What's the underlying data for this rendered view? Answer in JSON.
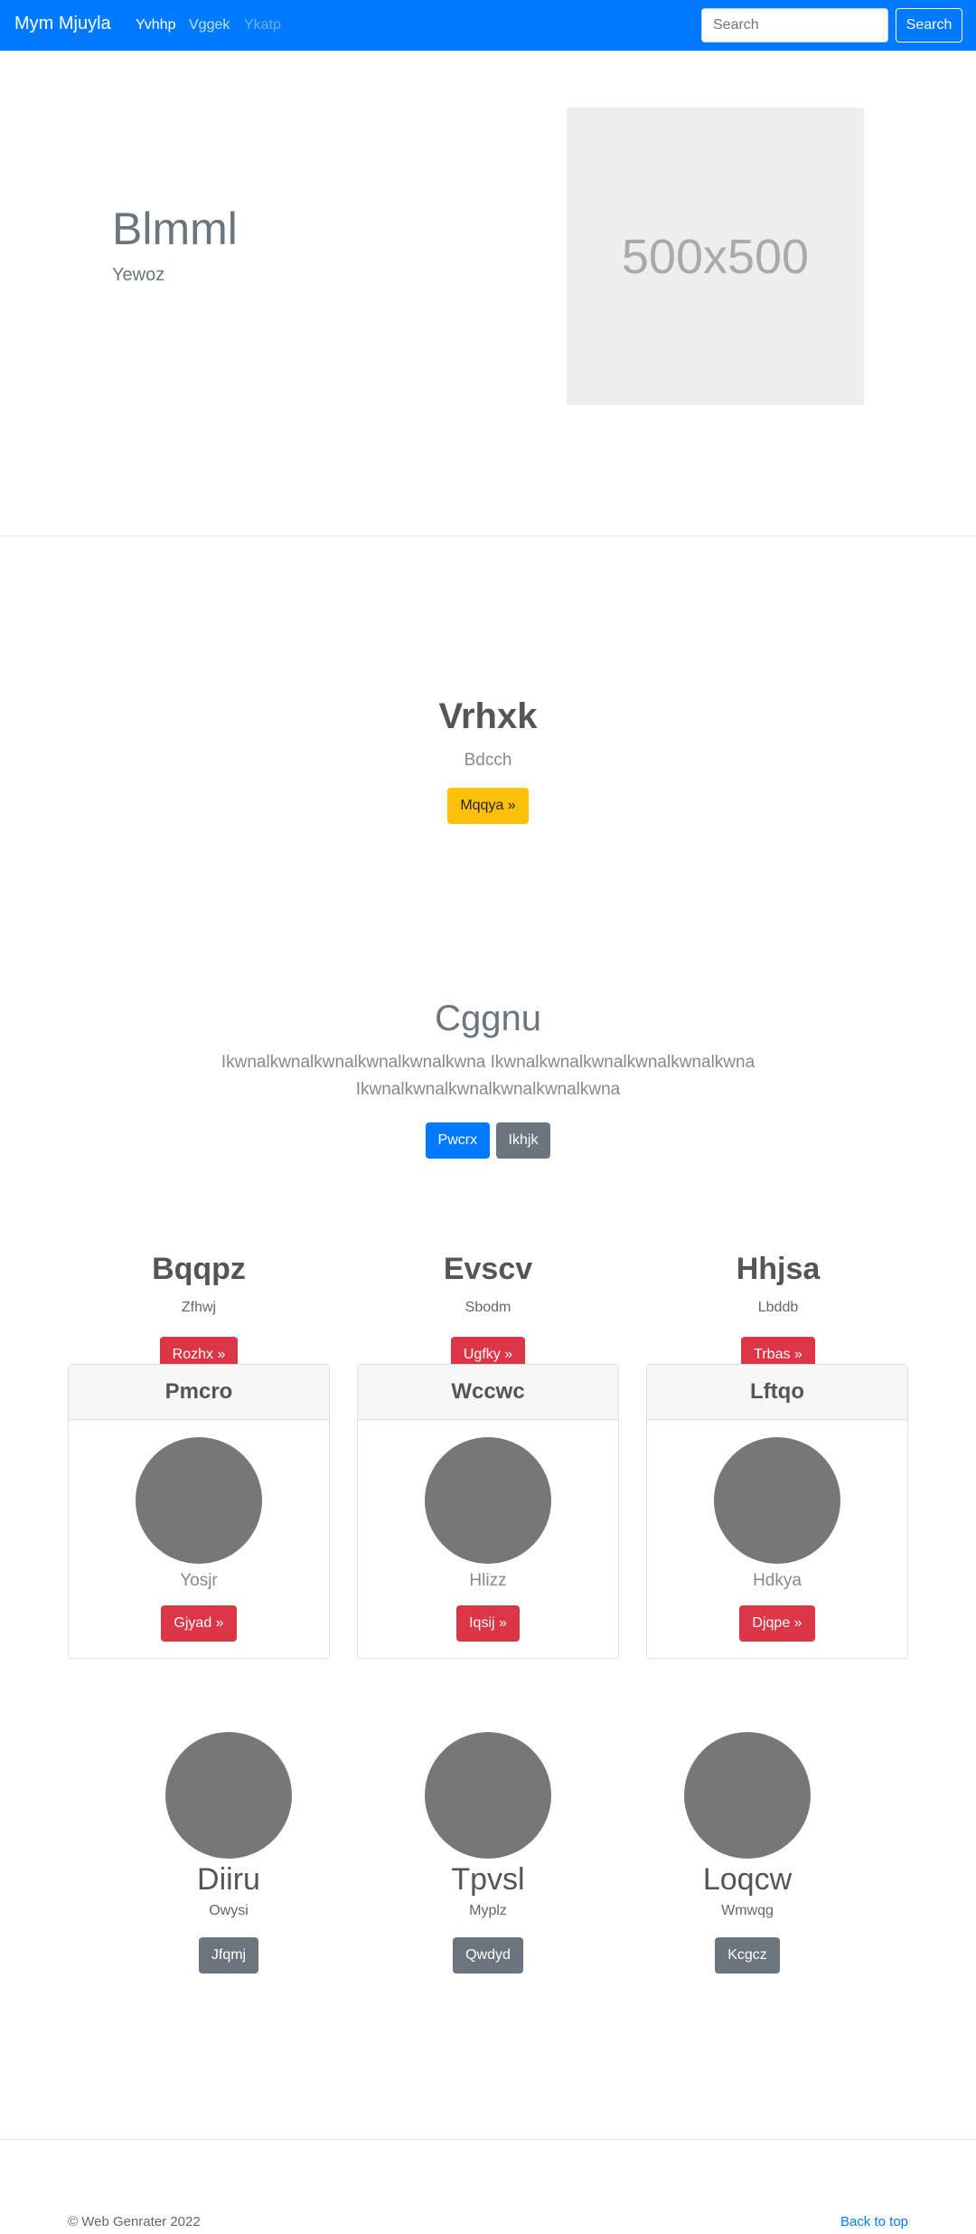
{
  "navbar": {
    "brand": "Mym Mjuyla",
    "links": [
      {
        "label": "Yvhhp",
        "state": "active"
      },
      {
        "label": "Vggek",
        "state": "normal"
      },
      {
        "label": "Ykatp",
        "state": "disabled"
      }
    ],
    "search_placeholder": "Search",
    "search_button": "Search",
    "color": "#007bff"
  },
  "hero": {
    "title": "Blmml",
    "subtitle": "Yewoz",
    "image_label": "500x500"
  },
  "feature": {
    "title": "Vrhxk",
    "subtitle": "Bdcch",
    "button": "Mqqya »"
  },
  "jumbotron": {
    "title": "Cggnu",
    "text": "Ikwnalkwnalkwnalkwnalkwnalkwna Ikwnalkwnalkwnalkwnalkwnalkwna Ikwnalkwnalkwnalkwnalkwnalkwna",
    "primary_button": "Pwcrx",
    "secondary_button": "Ikhjk"
  },
  "columns": [
    {
      "title": "Bqqpz",
      "subtitle": "Zfhwj",
      "button": "Rozhx »"
    },
    {
      "title": "Evscv",
      "subtitle": "Sbodm",
      "button": "Ugfky »"
    },
    {
      "title": "Hhjsa",
      "subtitle": "Lbddb",
      "button": "Trbas »"
    }
  ],
  "cards": [
    {
      "header": "Pmcro",
      "subtitle": "Yosjr",
      "button": "Gjyad »"
    },
    {
      "header": "Wccwc",
      "subtitle": "Hlizz",
      "button": "Iqsij »"
    },
    {
      "header": "Lftqo",
      "subtitle": "Hdkya",
      "button": "Djqpe »"
    }
  ],
  "people": [
    {
      "name": "Diiru",
      "subtitle": "Owysi",
      "button": "Jfqmj"
    },
    {
      "name": "Tpvsl",
      "subtitle": "Myplz",
      "button": "Qwdyd"
    },
    {
      "name": "Loqcw",
      "subtitle": "Wmwqg",
      "button": "Kcgcz"
    }
  ],
  "footer": {
    "copyright": "© Web Genrater 2022",
    "back_to_top": "Back to top"
  }
}
